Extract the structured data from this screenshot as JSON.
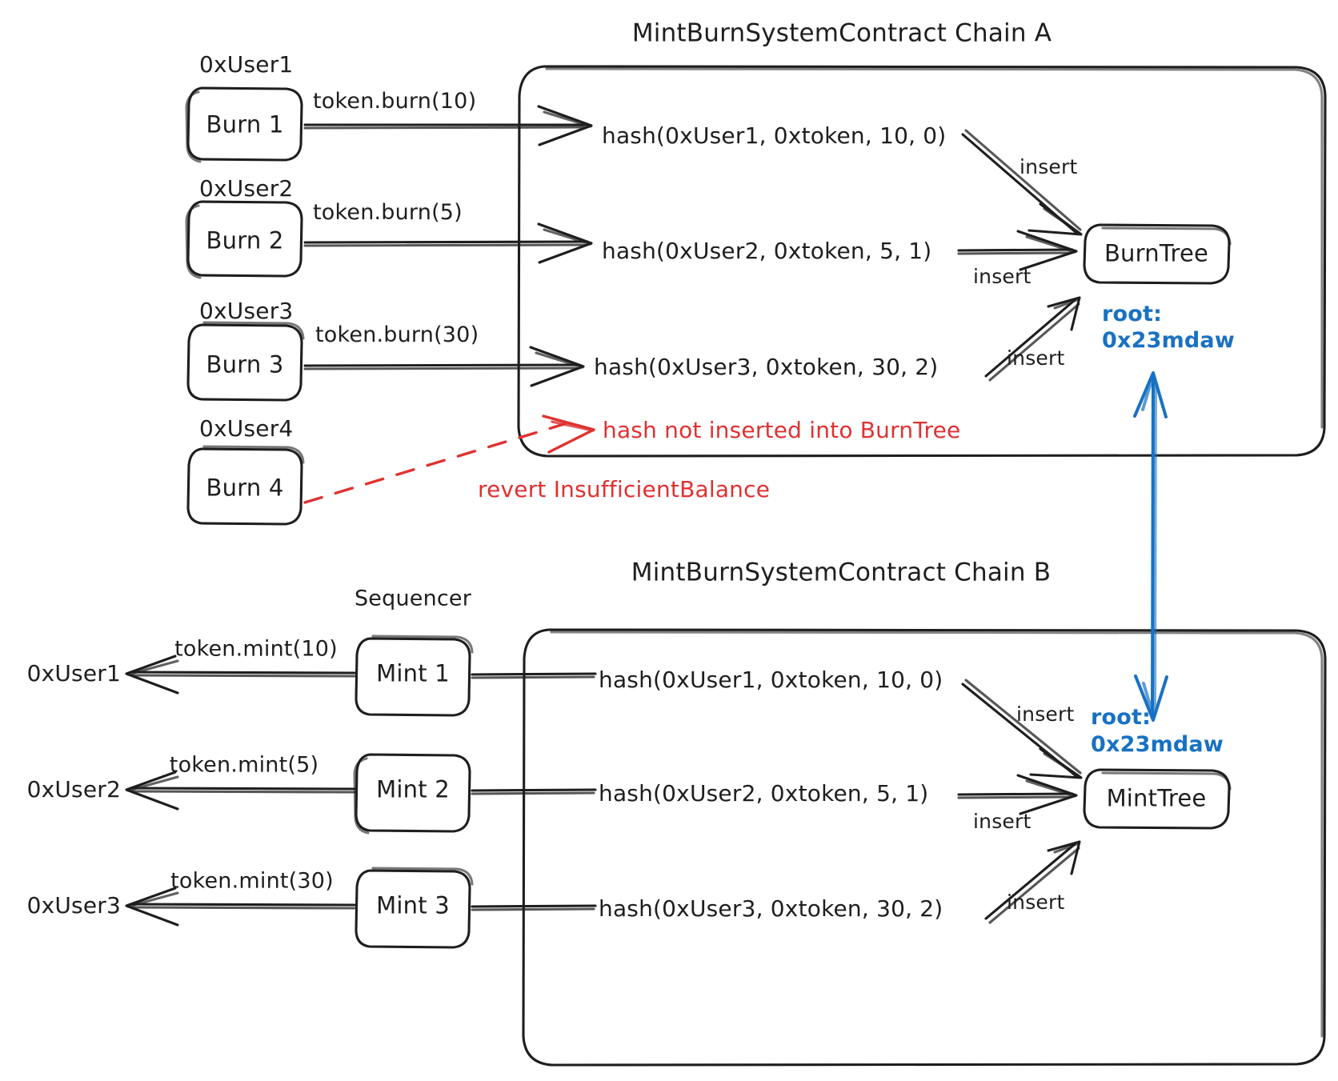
{
  "colors": {
    "ink": "#1e1e1e",
    "red": "#e03131",
    "blue": "#1971c2",
    "background": "#ffffff"
  },
  "chain_a": {
    "title": "MintBurnSystemContract Chain A",
    "actors": [
      {
        "user": "0xUser1",
        "box": "Burn 1",
        "call": "token.burn(10)"
      },
      {
        "user": "0xUser2",
        "box": "Burn 2",
        "call": "token.burn(5)"
      },
      {
        "user": "0xUser3",
        "box": "Burn 3",
        "call": "token.burn(30)"
      },
      {
        "user": "0xUser4",
        "box": "Burn 4",
        "call": ""
      }
    ],
    "hashes": [
      "hash(0xUser1, 0xtoken, 10, 0)",
      "hash(0xUser2, 0xtoken, 5, 1)",
      "hash(0xUser3, 0xtoken, 30, 2)"
    ],
    "insert_labels": [
      "insert",
      "insert",
      "insert"
    ],
    "tree": "BurnTree",
    "root_label": "root:",
    "root_value": "0x23mdaw",
    "error_inline": "hash not inserted into BurnTree",
    "error_revert": "revert InsufficientBalance"
  },
  "chain_b": {
    "title": "MintBurnSystemContract Chain B",
    "sequencer_label": "Sequencer",
    "actors": [
      {
        "user": "0xUser1",
        "box": "Mint 1",
        "call": "token.mint(10)"
      },
      {
        "user": "0xUser2",
        "box": "Mint 2",
        "call": "token.mint(5)"
      },
      {
        "user": "0xUser3",
        "box": "Mint 3",
        "call": "token.mint(30)"
      }
    ],
    "hashes": [
      "hash(0xUser1, 0xtoken, 10, 0)",
      "hash(0xUser2, 0xtoken, 5, 1)",
      "hash(0xUser3, 0xtoken, 30, 2)"
    ],
    "insert_labels": [
      "insert",
      "insert",
      "insert"
    ],
    "tree": "MintTree",
    "root_label": "root:",
    "root_value": "0x23mdaw"
  }
}
